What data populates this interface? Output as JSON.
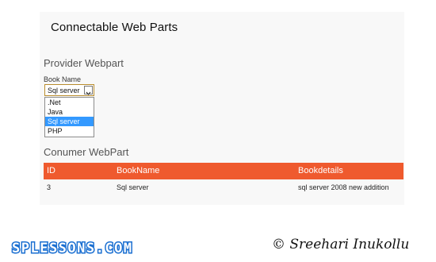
{
  "header": {
    "title": "Connectable Web Parts"
  },
  "provider": {
    "title": "Provider Webpart",
    "field_label": "Book Name",
    "selected_value": "Sql server",
    "options": [
      ".Net",
      "Java",
      "Sql server",
      "PHP"
    ],
    "highlighted_option": "Sql server"
  },
  "consumer": {
    "title": "Conumer WebPart",
    "columns": [
      "ID",
      "BookName",
      "Bookdetails"
    ],
    "rows": [
      {
        "id": "3",
        "book_name": "Sql server",
        "book_details": "sql server 2008 new addition"
      }
    ]
  },
  "footer": {
    "brand": "SPLESSONS.COM",
    "copyright": "© Sreehari Inukollu"
  },
  "colors": {
    "header_bar": "#ef5a2e",
    "option_highlight": "#3399ff",
    "brand_blue": "#1a6fd1"
  },
  "icons": {
    "dropdown": "chevron-down-icon"
  }
}
